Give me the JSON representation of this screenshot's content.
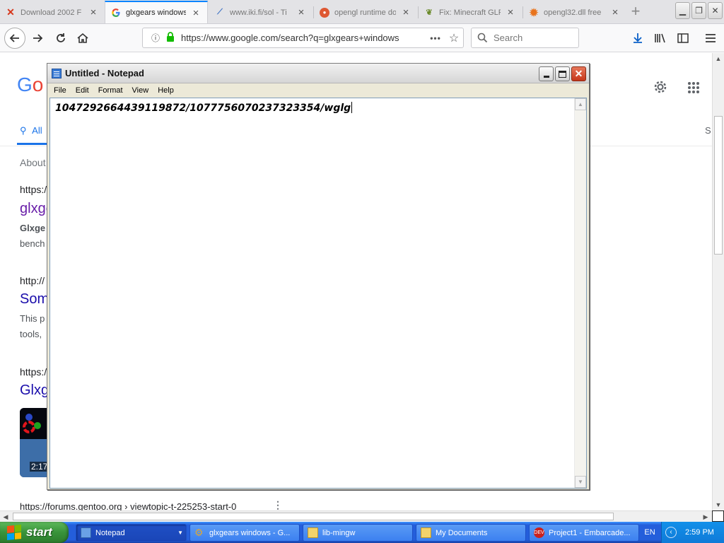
{
  "browser": {
    "tabs": [
      {
        "label": "Download 2002 F",
        "favicon": "x-icon",
        "color": "#d7361a"
      },
      {
        "label": "glxgears windows",
        "favicon": "google-g-icon",
        "color": "#4285f4"
      },
      {
        "label": "www.iki.fi/sol - Ti",
        "favicon": "sol-icon",
        "color": "#3a6fc4"
      },
      {
        "label": "opengl runtime do",
        "favicon": "duckduckgo-icon",
        "color": "#de5833"
      },
      {
        "label": "Fix: Minecraft GLF",
        "favicon": "leaf-icon",
        "color": "#6a8a2a"
      },
      {
        "label": "opengl32.dll free",
        "favicon": "gear-orange-icon",
        "color": "#e8731c"
      }
    ],
    "url": "https://www.google.com/search?q=glxgears+windows",
    "search_placeholder": "Search"
  },
  "google": {
    "logo_partial": "Go",
    "tab_all": "All",
    "tab_right_partial": "S",
    "about_partial": "About",
    "results": [
      {
        "url_partial": "https:/",
        "title_partial": "glxge",
        "snippet": [
          "Glxge",
          "bench"
        ]
      },
      {
        "url_partial": "http://",
        "title_partial": "Som",
        "snippet": [
          "This p",
          "tools,"
        ]
      },
      {
        "url_partial": "https:/",
        "title_partial": "Glxg",
        "video_duration": "2:17"
      }
    ],
    "bottom_url": "https://forums.gentoo.org › viewtopic-t-225253-start-0"
  },
  "notepad": {
    "title": "Untitled - Notepad",
    "menu": [
      "File",
      "Edit",
      "Format",
      "View",
      "Help"
    ],
    "content": "1047292664439119872/1077756070237323354/wglg"
  },
  "taskbar": {
    "start_label": "start",
    "tasks": [
      {
        "label": "Notepad",
        "active": true
      },
      {
        "label": "glxgears windows - G...",
        "active": false
      },
      {
        "label": "lib-mingw",
        "active": false
      },
      {
        "label": "My Documents",
        "active": false
      },
      {
        "label": "Project1 - Embarcade...",
        "active": false
      }
    ],
    "language": "EN",
    "clock": "2:59 PM"
  }
}
